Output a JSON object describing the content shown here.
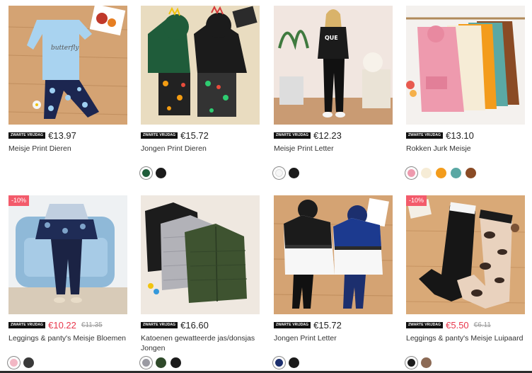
{
  "badge_label": "ZWARTE VRIJDAG",
  "products": [
    {
      "name": "Meisje Print Dieren",
      "price": "€13.97",
      "swatches": []
    },
    {
      "name": "Jongen Print Dieren",
      "price": "€15.72",
      "swatches": [
        "#1f5c3a",
        "#1b1b1b"
      ]
    },
    {
      "name": "Meisje Print Letter",
      "price": "€12.23",
      "swatches": [
        "#f7f7f7",
        "#1b1b1b"
      ]
    },
    {
      "name": "Rokken Jurk Meisje",
      "price": "€13.10",
      "swatches": [
        "#ee9aae",
        "#f6ecd6",
        "#f39c1c",
        "#5aa8a4",
        "#8a4b25"
      ]
    },
    {
      "name": "Leggings & panty's Meisje Bloemen",
      "price": "€10.22",
      "old_price": "€11.35",
      "discount": "-10%",
      "swatches": [
        "#f2b7c4",
        "#3a3a3a"
      ]
    },
    {
      "name": "Katoenen gewatteerde jas/donsjas Jongen",
      "price": "€16.60",
      "swatches": [
        "#9a9aa2",
        "#2f4a2a",
        "#1b1b1b"
      ]
    },
    {
      "name": "Jongen Print Letter",
      "price": "€15.72",
      "swatches": [
        "#1c2f6e",
        "#1b1b1b"
      ]
    },
    {
      "name": "Leggings & panty's Meisje Luipaard",
      "price": "€5.50",
      "old_price": "€6.11",
      "discount": "-10%",
      "swatches": [
        "#1b1b1b",
        "#8c6a55"
      ]
    }
  ]
}
